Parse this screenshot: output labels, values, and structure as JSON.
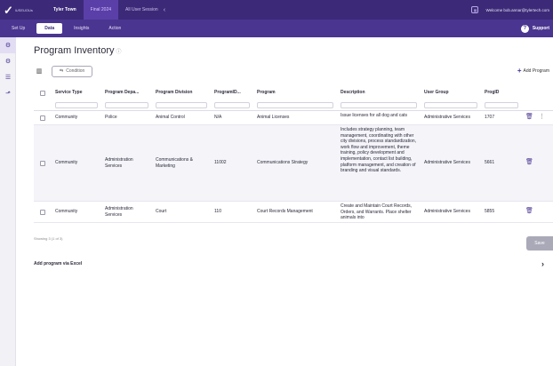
{
  "topbar": {
    "logo_text": "lUSEUOUs",
    "city": "Tyler Town",
    "tab_pill": "Final 2024",
    "session": "All User Session",
    "user": "Welcome bob.annar@tylertech.com"
  },
  "tabs": [
    "Set Up",
    "Data",
    "Insights",
    "Action"
  ],
  "active_tab": "Data",
  "support": "Support",
  "page": {
    "title": "Program Inventory",
    "condition_label": "Condition",
    "add_program": "Add Program"
  },
  "table": {
    "columns": [
      "Service Type",
      "Program Depa...",
      "Program Division",
      "ProgramID...",
      "Program",
      "Description",
      "User Group",
      "ProgID"
    ],
    "rows": [
      {
        "service_type": "Community",
        "department": "Police",
        "division": "Animal Control",
        "program_id": "N/A",
        "program": "Animal Licenses",
        "description": "Issue licenses for all dog and cats",
        "user_group": "Administrative Services",
        "prog_id": "1707"
      },
      {
        "service_type": "Community",
        "department": "Administration Services",
        "division": "Communications & Marketing",
        "program_id": "11002",
        "program": "Communications Strategy",
        "description": "Includes strategy planning, team management, coordinating with other city divisions, process standardization, work flow and improvement, theme training, policy development and implementation, contact list building, platform management, and creation of branding and visual standards.",
        "user_group": "Administrative Services",
        "prog_id": "5661"
      },
      {
        "service_type": "Community",
        "department": "Administration Services",
        "division": "Court",
        "program_id": "110",
        "program": "Court Records Management",
        "description": "Create and Maintain Court Records, Orders, and Warrants. Place shelter animals into",
        "user_group": "Administrative Services",
        "prog_id": "5855"
      }
    ]
  },
  "showing_text": "Showing 3 (1 of 3)",
  "save_label": "Save",
  "add_via_excel": "Add program via Excel"
}
